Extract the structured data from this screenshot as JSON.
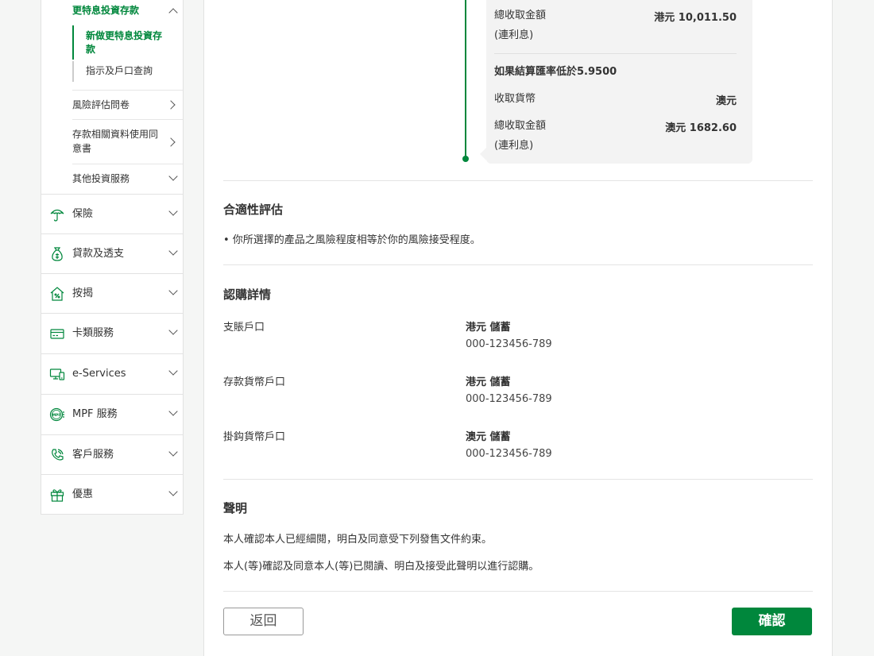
{
  "sidebar": {
    "investment_sub": {
      "title": "更特息投資存款",
      "leaf_new": "新做更特息投資存款",
      "leaf_query": "指示及戶口查詢",
      "risk_questionnaire": "風險評估問卷",
      "consent": "存款相關資料使用同意書",
      "other_services": "其他投資服務"
    },
    "items": [
      {
        "label": "保險",
        "icon": "umbrella-icon"
      },
      {
        "label": "貸款及透支",
        "icon": "money-bag-icon"
      },
      {
        "label": "按揭",
        "icon": "house-percent-icon"
      },
      {
        "label": "卡類服務",
        "icon": "card-icon"
      },
      {
        "label": "e-Services",
        "icon": "devices-icon"
      },
      {
        "label": "MPF 服務",
        "icon": "mpf-icon"
      },
      {
        "label": "客戶服務",
        "icon": "phone-hand-icon"
      },
      {
        "label": "優惠",
        "icon": "gift-icon"
      }
    ]
  },
  "rate_box": {
    "total_label_1": "總收取金額",
    "total_sub_1": "(連利息)",
    "total_value_1": "港元 10,011.50",
    "condition": "如果結算匯率低於5.9500",
    "currency_label": "收取貨幣",
    "currency_value": "澳元",
    "total_label_2": "總收取金額",
    "total_sub_2": "(連利息)",
    "total_value_2": "澳元 1682.60"
  },
  "suitability": {
    "heading": "合適性評估",
    "text": "• 你所選擇的產品之風險程度相等於你的風險接受程度。"
  },
  "subscription": {
    "heading": "認購詳情",
    "rows": [
      {
        "label": "支賬戶口",
        "type": "港元 儲蓄",
        "number": "000-123456-789"
      },
      {
        "label": "存款貨幣戶口",
        "type": "港元 儲蓄",
        "number": "000-123456-789"
      },
      {
        "label": "掛鈎貨幣戶口",
        "type": "澳元 儲蓄",
        "number": "000-123456-789"
      }
    ]
  },
  "declaration": {
    "heading": "聲明",
    "line1": "本人確認本人已經細閱，明白及同意受下列發售文件約束。",
    "line2": "本人(等)確認及同意本人(等)已閱讀、明白及接受此聲明以進行認購。"
  },
  "buttons": {
    "back": "返回",
    "confirm": "確認"
  },
  "colors": {
    "brand_green": "#00873c"
  }
}
